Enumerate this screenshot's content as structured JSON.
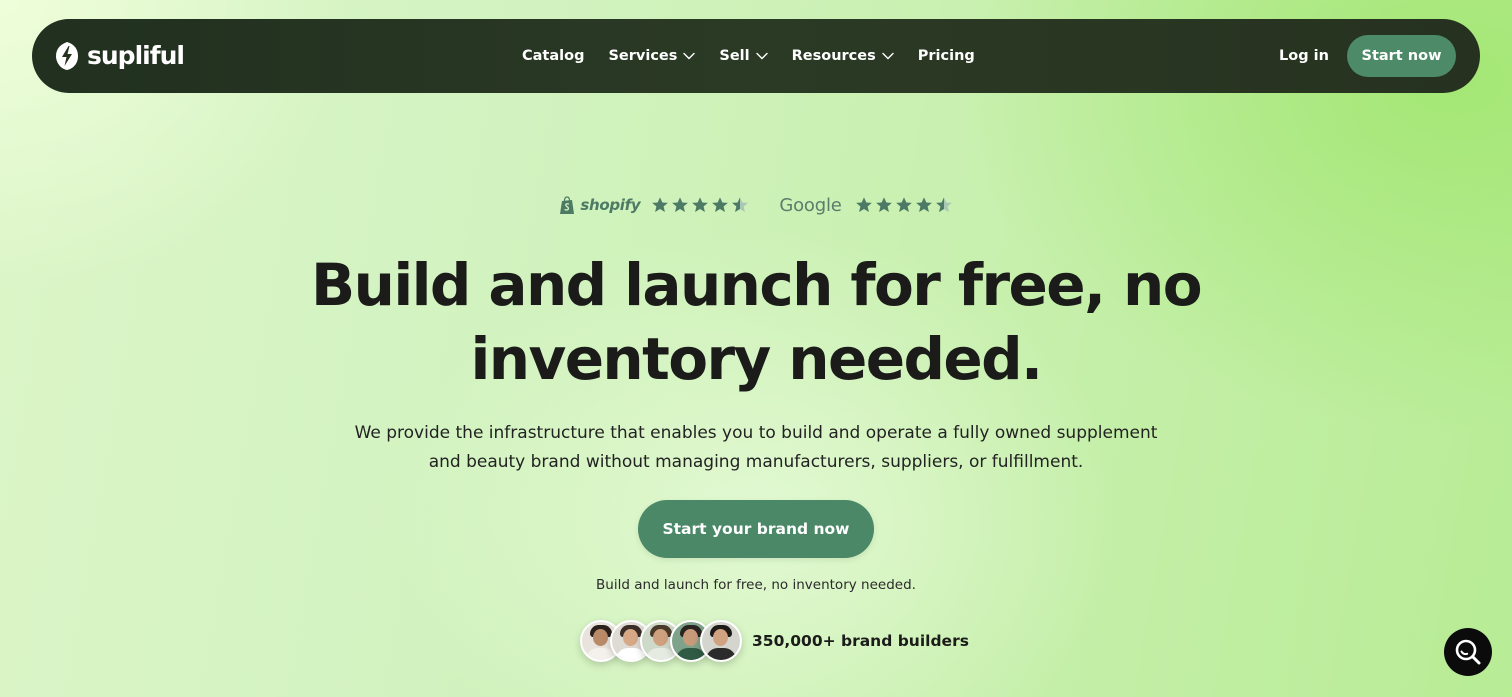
{
  "nav": {
    "logo_text": "supliful",
    "logo_icon": "bolt-logo-icon",
    "menu": [
      {
        "label": "Catalog",
        "has_dropdown": false
      },
      {
        "label": "Services",
        "has_dropdown": true
      },
      {
        "label": "Sell",
        "has_dropdown": true
      },
      {
        "label": "Resources",
        "has_dropdown": true
      },
      {
        "label": "Pricing",
        "has_dropdown": false
      }
    ],
    "login_label": "Log in",
    "start_label": "Start now"
  },
  "ratings": {
    "shopify": {
      "label": "shopify",
      "icon": "shopify-bag-icon",
      "stars": 4.5
    },
    "google": {
      "label": "Google",
      "stars": 4.5
    }
  },
  "hero": {
    "headline_line1": "Build and launch for free, no",
    "headline_line2": "inventory needed.",
    "subtext_line1": "We provide the infrastructure that enables you to build and operate a fully owned supplement",
    "subtext_line2": "and beauty brand without managing manufacturers, suppliers, or fulfillment.",
    "cta_label": "Start your brand now",
    "cta_caption": "Build and launch for free, no inventory needed."
  },
  "social_proof": {
    "avatar_count": 5,
    "text": "350,000+ brand builders"
  },
  "chat": {
    "icon": "search-chat-icon"
  },
  "colors": {
    "nav_bg": "#26321f",
    "accent_green": "#4b8868",
    "star_green": "#4d7a65",
    "headline": "#1b1c1a"
  }
}
